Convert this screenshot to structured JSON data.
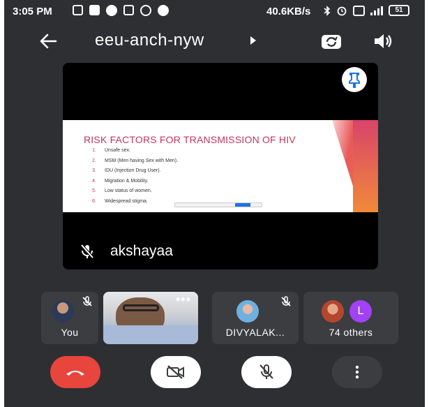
{
  "status_bar": {
    "time": "3:05 PM",
    "network_speed": "40.6KB/s",
    "battery": "51",
    "notification_icons": [
      "message-icon",
      "gallery-icon",
      "jio-icon",
      "chat-icon",
      "whatsapp-icon",
      "vpn-icon"
    ],
    "system_icons": [
      "bluetooth-icon",
      "alarm-icon",
      "volte-icon",
      "signal-icon",
      "battery-icon"
    ]
  },
  "header": {
    "meeting_code": "eeu-anch-nyw",
    "icons": [
      "back-arrow-icon",
      "caret-right-icon",
      "switch-camera-icon",
      "speaker-icon"
    ]
  },
  "main_tile": {
    "speaker_name": "akshayaa",
    "slide": {
      "title": "RISK FACTORS FOR TRANSMISSION OF HIV",
      "items": [
        {
          "num": "1.",
          "text": "Unsafe sex."
        },
        {
          "num": "2.",
          "text": "MSM (Men having Sex with Men)."
        },
        {
          "num": "3.",
          "text": "IDU (Injection Drug User)."
        },
        {
          "num": "4.",
          "text": "Migration & Mobility."
        },
        {
          "num": "5.",
          "text": "Low status of women."
        },
        {
          "num": "6.",
          "text": "Widespread stigma."
        }
      ]
    },
    "icons": [
      "pin-icon",
      "mic-off-icon"
    ]
  },
  "participants": {
    "you_label": "You",
    "divya_label": "DIVYALAK...",
    "others_label": "74 others",
    "others_avatar_letter": "L"
  },
  "colors": {
    "background": "#2e2f32",
    "tile": "#3c3d41",
    "end_call": "#e8453c",
    "slide_title": "#c5355a"
  },
  "controls": {
    "icons": [
      "end-call-icon",
      "camera-off-icon",
      "mic-off-icon",
      "more-vert-icon"
    ]
  }
}
